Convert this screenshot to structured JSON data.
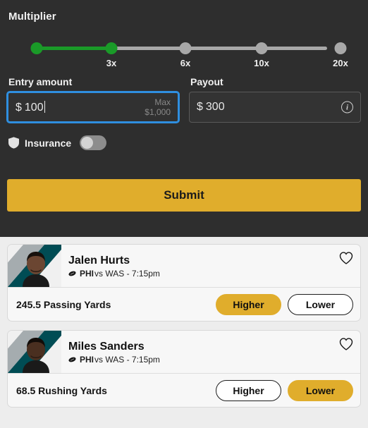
{
  "panel": {
    "multiplier": {
      "title": "Multiplier",
      "selected_label": "3x",
      "stops": [
        {
          "label": "",
          "active": true,
          "pos": 42
        },
        {
          "label": "3x",
          "active": true,
          "pos": 148
        },
        {
          "label": "6x",
          "active": false,
          "pos": 253
        },
        {
          "label": "10x",
          "active": false,
          "pos": 361
        },
        {
          "label": "20x",
          "active": false,
          "pos": 473
        }
      ]
    },
    "entry": {
      "label": "Entry amount",
      "currency": "$",
      "value": "100",
      "placeholder": "0",
      "max_label": "Max",
      "max_value": "$1,000"
    },
    "payout": {
      "label": "Payout",
      "currency": "$",
      "value": "300",
      "info_icon": "info-circle-icon",
      "info_glyph": "i"
    },
    "insurance": {
      "label": "Insurance",
      "icon": "shield-icon",
      "enabled": false
    },
    "submit_label": "Submit"
  },
  "cards": [
    {
      "player_name": "Jalen Hurts",
      "team": "PHI",
      "matchup": " vs WAS - 7:15pm",
      "sport_icon": "football-icon",
      "favorite_icon": "heart-outline-icon",
      "stat": "245.5 Passing Yards",
      "higher_label": "Higher",
      "lower_label": "Lower",
      "selection": "higher",
      "team_colors": {
        "primary": "#004c54",
        "secondary": "#a5acaf"
      },
      "skin": "#6b4632",
      "hair": "#17110d"
    },
    {
      "player_name": "Miles Sanders",
      "team": "PHI",
      "matchup": " vs WAS - 7:15pm",
      "sport_icon": "football-icon",
      "favorite_icon": "heart-outline-icon",
      "stat": "68.5 Rushing Yards",
      "higher_label": "Higher",
      "lower_label": "Lower",
      "selection": "lower",
      "team_colors": {
        "primary": "#004c54",
        "secondary": "#a5acaf"
      },
      "skin": "#4a2f20",
      "hair": "#120c08"
    }
  ],
  "colors": {
    "panel_bg": "#2e2e2e",
    "accent": "#e0ad2c",
    "slider_active": "#1a9a28",
    "slider_inactive": "#a8a8a8",
    "focus_ring": "#2f8fe0",
    "page_bg": "#ededed"
  }
}
